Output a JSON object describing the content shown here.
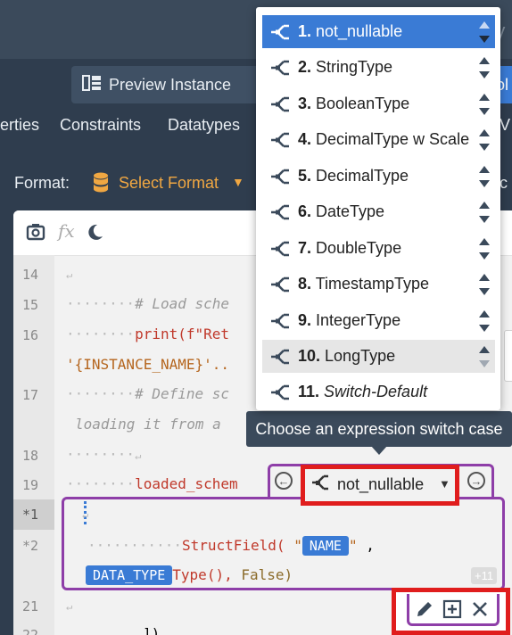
{
  "header": {
    "ghost_text": "ry"
  },
  "toolbar": {
    "preview_label": "Preview Instance",
    "right_button_label": "ol"
  },
  "tabs": {
    "items": [
      "erties",
      "Constraints",
      "Datatypes"
    ],
    "end_label": "V"
  },
  "format": {
    "label": "Format:",
    "select_label": "Select Format",
    "right_label": "ic"
  },
  "gutter": {
    "lines": [
      "14",
      "15",
      "16",
      "",
      "17",
      "",
      "18",
      "19",
      "*1",
      "*2",
      "",
      "21",
      "22"
    ]
  },
  "code": {
    "l14": "↵",
    "l15_comment": "# Load sche",
    "l16_fn": "print(f\"Ret",
    "l16b_str": "'{INSTANCE_NAME}'..",
    "l17_comment": "# Define sc",
    "l17b_comment": "loading it from a",
    "l18": "↵",
    "l19_text": "loaded_schem",
    "ret": "↵",
    "struct_fn": "StructField(",
    "quote_open": "\"",
    "name_chip": "NAME",
    "quote_close": "\"",
    "comma": ",",
    "datatype_chip": "DATA_TYPE",
    "type_call": "Type(),",
    "false_kw": "False)",
    "l21": "↵",
    "l22": "])",
    "more_badge": "+11"
  },
  "switch": {
    "selected": "not_nullable"
  },
  "tooltip": {
    "text": "Choose an expression switch case"
  },
  "dropdown": {
    "items": [
      {
        "num": "1.",
        "label": "not_nullable",
        "state": "active"
      },
      {
        "num": "2.",
        "label": "StringType"
      },
      {
        "num": "3.",
        "label": "BooleanType"
      },
      {
        "num": "4.",
        "label": "DecimalType w Scale"
      },
      {
        "num": "5.",
        "label": "DecimalType"
      },
      {
        "num": "6.",
        "label": "DateType"
      },
      {
        "num": "7.",
        "label": "DoubleType"
      },
      {
        "num": "8.",
        "label": "TimestampType"
      },
      {
        "num": "9.",
        "label": "IntegerType"
      },
      {
        "num": "10.",
        "label": "LongType",
        "state": "hover"
      },
      {
        "num": "11.",
        "label": "Switch-Default",
        "italic": true
      }
    ]
  },
  "colors": {
    "accent": "#3a7bd5",
    "highlight_red": "#e01d1d",
    "purple": "#8e3ea8",
    "format_orange": "#f0a742"
  }
}
